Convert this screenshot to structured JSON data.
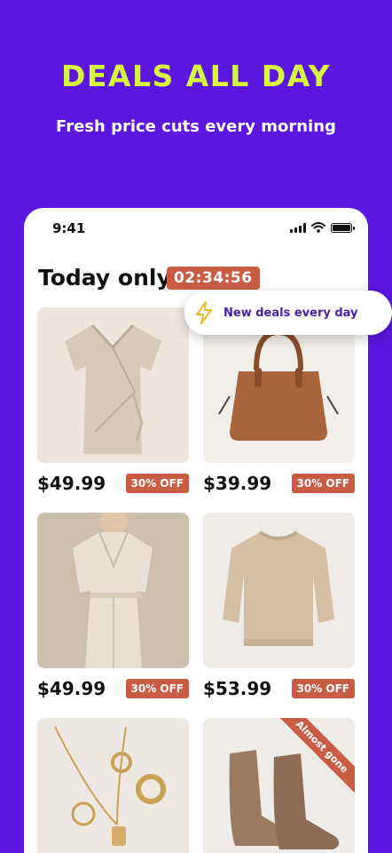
{
  "hero": {
    "title": "DEALS ALL DAY",
    "subtitle": "Fresh price cuts every morning"
  },
  "status_bar": {
    "time": "9:41",
    "icons": [
      "signal-icon",
      "wifi-icon",
      "battery-icon"
    ]
  },
  "section": {
    "title": "Today only",
    "countdown": "02:34:56"
  },
  "toast": {
    "icon": "lightning-icon",
    "text": "New deals every day"
  },
  "products": [
    {
      "name": "wrap-dress",
      "price": "$49.99",
      "discount": "30% OFF"
    },
    {
      "name": "leather-handbag",
      "price": "$39.99",
      "discount": "30% OFF"
    },
    {
      "name": "linen-jumpsuit",
      "price": "$49.99",
      "discount": "30% OFF"
    },
    {
      "name": "knit-sweater",
      "price": "$53.99",
      "discount": "30% OFF"
    },
    {
      "name": "gold-jewelry",
      "price": "",
      "discount": ""
    },
    {
      "name": "suede-boots",
      "price": "",
      "discount": "",
      "badge": "Almost gone"
    }
  ],
  "colors": {
    "background": "#5b16e0",
    "hero_title": "#d8f53d",
    "accent": "#c95d43",
    "toast_text": "#4a1fa8"
  }
}
